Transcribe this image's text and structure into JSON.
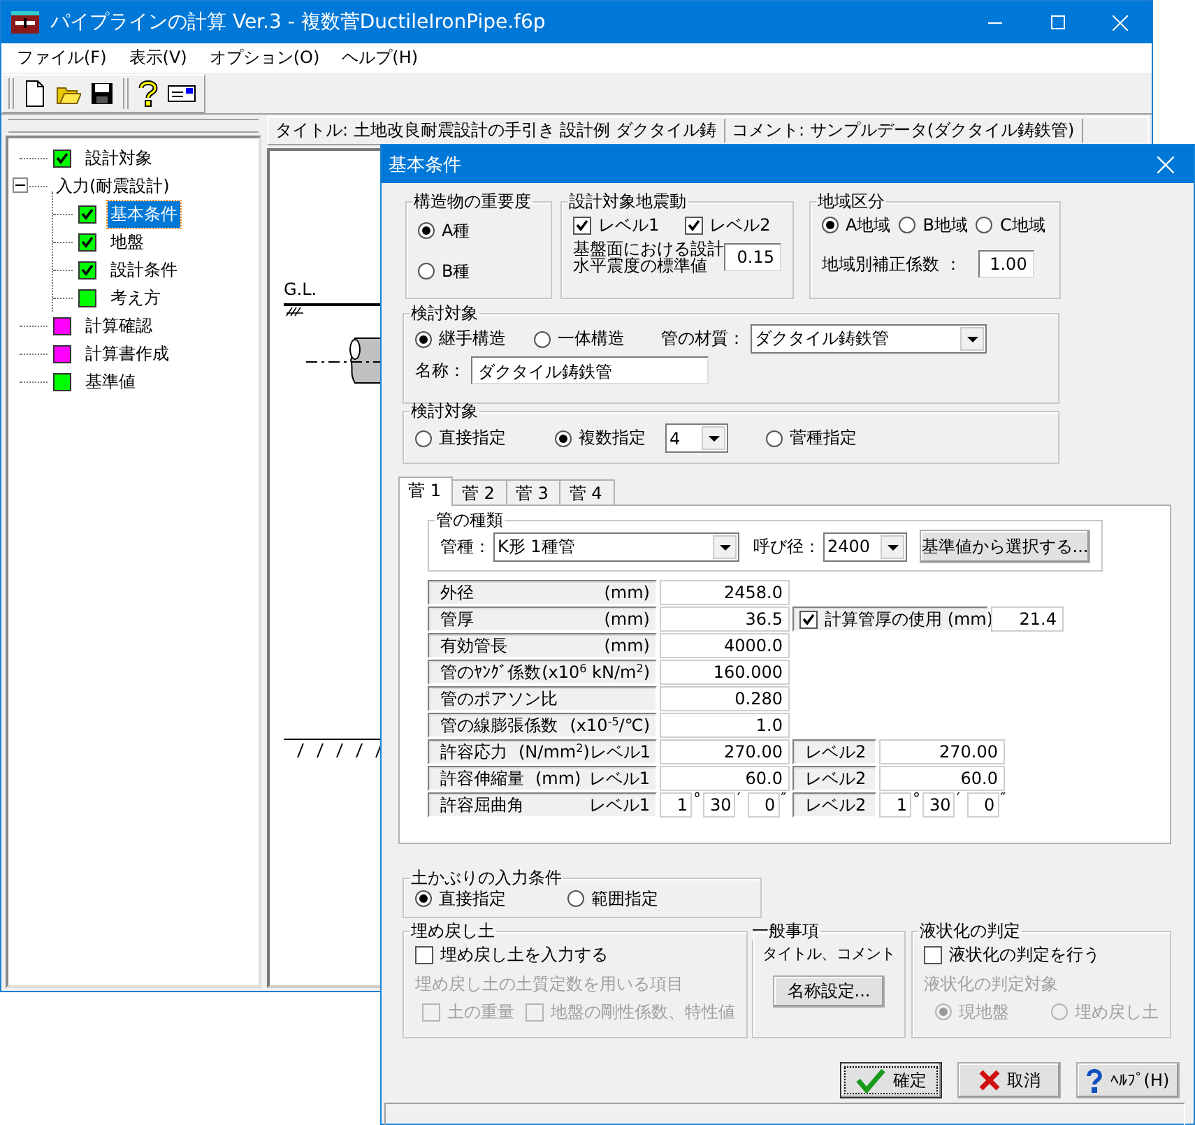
{
  "app": {
    "title": "パイプラインの計算 Ver.3 - 複数菅DuctileIronPipe.f6p",
    "menu": [
      "ファイル(F)",
      "表示(V)",
      "オプション(O)",
      "ヘルプ(H)"
    ],
    "tree": [
      {
        "label": "設計対象",
        "color": "#00ff00",
        "checked": true,
        "selected": false
      },
      {
        "label": "入力(耐震設計)",
        "expanded": true,
        "selected": false,
        "children": [
          {
            "label": "基本条件",
            "color": "#00ff00",
            "checked": true,
            "selected": true
          },
          {
            "label": "地盤",
            "color": "#00ff00",
            "checked": true,
            "selected": false
          },
          {
            "label": "設計条件",
            "color": "#00ff00",
            "checked": true,
            "selected": false
          },
          {
            "label": "考え方",
            "color": "#00ff00",
            "checked": false,
            "selected": false
          }
        ]
      },
      {
        "label": "計算確認",
        "color": "#ff00ff",
        "checked": false,
        "selected": false
      },
      {
        "label": "計算書作成",
        "color": "#ff00ff",
        "checked": false,
        "selected": false
      },
      {
        "label": "基準値",
        "color": "#00ff00",
        "checked": false,
        "selected": false
      }
    ],
    "header": {
      "title": "タイトル: 土地改良耐震設計の手引き 設計例 ダクタイル鋳",
      "comment": "コメント: サンプルデータ(ダクタイル鋳鉄管)"
    },
    "drawing": {
      "gl_label": "G.L."
    }
  },
  "dialog": {
    "title": "基本条件",
    "importance": {
      "label": "構造物の重要度",
      "options": [
        {
          "label": "A種",
          "selected": true
        },
        {
          "label": "B種",
          "selected": false
        }
      ]
    },
    "earthquake": {
      "label": "設計対象地震動",
      "levels": [
        {
          "label": "レベル1",
          "checked": true
        },
        {
          "label": "レベル2",
          "checked": true
        }
      ],
      "seismic_label": [
        "基盤面における設計",
        "水平震度の標準値"
      ],
      "seismic_value": "0.15"
    },
    "region": {
      "label": "地域区分",
      "options": [
        {
          "label": "A地域",
          "selected": true
        },
        {
          "label": "B地域",
          "selected": false
        },
        {
          "label": "C地域",
          "selected": false
        }
      ],
      "factor_label": "地域別補正係数 ：",
      "factor_value": "1.00"
    },
    "structure": {
      "label": "検討対象",
      "options": [
        {
          "label": "継手構造",
          "selected": true
        },
        {
          "label": "一体構造",
          "selected": false
        }
      ],
      "material_label": "管の材質：",
      "material": "ダクタイル鋳鉄管",
      "name_label": "名称：",
      "name": "ダクタイル鋳鉄管"
    },
    "target": {
      "label": "検討対象",
      "options": [
        {
          "label": "直接指定",
          "selected": false
        },
        {
          "label": "複数指定",
          "selected": true
        },
        {
          "label": "菅種指定",
          "selected": false
        }
      ],
      "count": "4"
    },
    "tabs": [
      {
        "label": "菅 1",
        "selected": true
      },
      {
        "label": "菅 2",
        "selected": false
      },
      {
        "label": "菅 3",
        "selected": false
      },
      {
        "label": "菅 4",
        "selected": false
      }
    ],
    "pipe_type": {
      "label": "管の種類",
      "type_label": "管種：",
      "type": "K形 1種管",
      "diameter_label": "呼び径：",
      "diameter": "2400",
      "select_button": "基準値から選択する..."
    },
    "properties": [
      {
        "kind": "single",
        "label": "外径",
        "unit": "(mm)",
        "value": "2458.0"
      },
      {
        "kind": "check",
        "label": "管厚",
        "unit": "(mm)",
        "value": "36.5",
        "check_label": "計算管厚の使用 (mm)",
        "checked": true,
        "check_value": "21.4"
      },
      {
        "kind": "single",
        "label": "有効管長",
        "unit": "(mm)",
        "value": "4000.0"
      },
      {
        "kind": "single",
        "label": "管のﾔﾝｸﾞ係数",
        "unit": "(x10$^{6}$ kN/m$^{2}$)",
        "value": "160.000"
      },
      {
        "kind": "single",
        "label": "管のポアソン比",
        "value": "0.280"
      },
      {
        "kind": "single",
        "label": "管の線膨張係数",
        "unit": "(x10$^{-5}$/℃)",
        "value": "1.0"
      },
      {
        "kind": "levels",
        "label": "許容応力",
        "unit": "(N/mm$^{2}$)",
        "level1_label": "レベル1",
        "value1": "270.00",
        "level2_label": "レベル2",
        "value2": "270.00"
      },
      {
        "kind": "levels",
        "label": "許容伸縮量",
        "unit": "(mm)",
        "level1_label": "レベル1",
        "value1": "60.0",
        "level2_label": "レベル2",
        "value2": "60.0"
      },
      {
        "kind": "angle",
        "label": "許容屈曲角",
        "level1_label": "レベル1",
        "angle1": [
          {
            "value": "1",
            "mark": "°"
          },
          {
            "value": "30",
            "mark": "′"
          },
          {
            "value": "0",
            "mark": "″"
          }
        ],
        "level2_label": "レベル2",
        "angle2": [
          {
            "value": "1",
            "mark": "°"
          },
          {
            "value": "30",
            "mark": "′"
          },
          {
            "value": "0",
            "mark": "″"
          }
        ]
      }
    ],
    "cover": {
      "label": "土かぶりの入力条件",
      "options": [
        {
          "label": "直接指定",
          "selected": true
        },
        {
          "label": "範囲指定",
          "selected": false
        }
      ]
    },
    "backfill": {
      "label": "埋め戻し土",
      "input": {
        "label": "埋め戻し土を入力する",
        "checked": false
      },
      "items_label": {
        "text": "埋め戻し土の土質定数を用いる項目",
        "disabled": true
      },
      "items": [
        {
          "label": "土の重量",
          "checked": false,
          "disabled": true
        },
        {
          "label": "地盤の剛性係数、特性値",
          "checked": false,
          "disabled": true
        }
      ]
    },
    "general": {
      "label": "一般事項",
      "text": "タイトル、コメント",
      "button": "名称設定..."
    },
    "liquefaction": {
      "label": "液状化の判定",
      "check": {
        "label": "液状化の判定を行う",
        "checked": false
      },
      "target_label": {
        "text": "液状化の判定対象",
        "disabled": true
      },
      "options": [
        {
          "label": "現地盤",
          "selected": true,
          "disabled": true
        },
        {
          "label": "埋め戻し土",
          "selected": false,
          "disabled": true
        }
      ]
    },
    "buttons": [
      {
        "label": "確定",
        "kind": "ok",
        "focused": true
      },
      {
        "label": "取消",
        "kind": "cancel",
        "focused": false
      },
      {
        "label": "ﾍﾙﾌﾟ(H)",
        "kind": "help",
        "focused": false
      }
    ]
  }
}
